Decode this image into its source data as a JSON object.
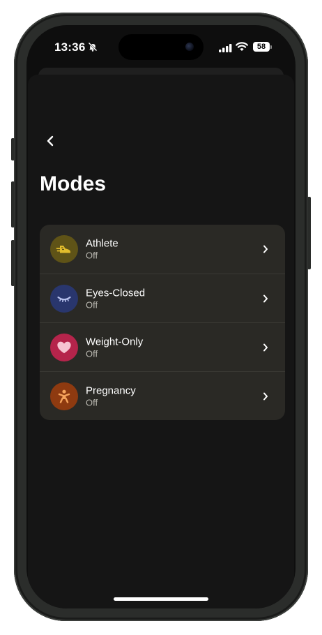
{
  "status_bar": {
    "time": "13:36",
    "battery_level": "58",
    "icons": [
      "bell-slash-icon",
      "cellular-signal-icon",
      "wifi-icon",
      "battery-icon"
    ]
  },
  "header": {
    "back_icon": "chevron-left-icon",
    "title": "Modes"
  },
  "modes": [
    {
      "name": "Athlete",
      "status": "Off",
      "icon": "running-shoe-icon",
      "icon_bg": "#5f5317",
      "icon_fg": "#e3bd2c"
    },
    {
      "name": "Eyes-Closed",
      "status": "Off",
      "icon": "closed-eye-icon",
      "icon_bg": "#29366d",
      "icon_fg": "#b8c2ee"
    },
    {
      "name": "Weight-Only",
      "status": "Off",
      "icon": "heart-icon",
      "icon_bg": "#b5244b",
      "icon_fg": "#f6c4d2"
    },
    {
      "name": "Pregnancy",
      "status": "Off",
      "icon": "person-icon",
      "icon_bg": "#8e3a10",
      "icon_fg": "#f6a45c"
    }
  ],
  "colors": {
    "background": "#151515",
    "card": "#2a2925",
    "text_primary": "#ffffff",
    "text_secondary": "#b9b7b0"
  }
}
